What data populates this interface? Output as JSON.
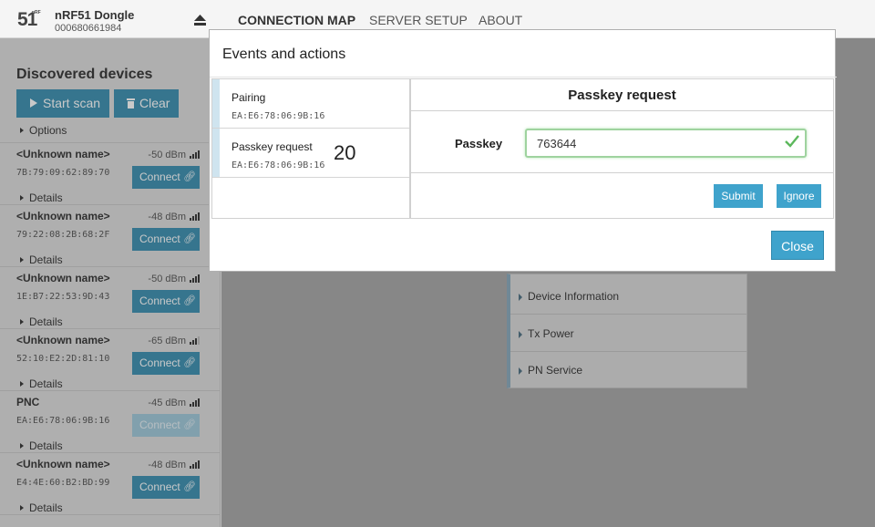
{
  "header": {
    "logo_number": "51",
    "logo_small_text": "nRF",
    "device_title": "nRF51 Dongle",
    "device_serial": "000680661984",
    "eject_icon": "eject-icon",
    "nav": [
      "CONNECTION MAP",
      "SERVER SETUP",
      "ABOUT"
    ],
    "active_nav": "CONNECTION MAP"
  },
  "sidebar": {
    "title": "Discovered devices",
    "start_scan_label": "Start scan",
    "clear_label": "Clear",
    "options_label": "Options",
    "connect_label": "Connect",
    "details_label": "Details",
    "devices": [
      {
        "name": "<Unknown name>",
        "rssi": "-50 dBm",
        "signal_bars": 4,
        "address": "7B:79:09:62:89:70",
        "connect_enabled": true
      },
      {
        "name": "<Unknown name>",
        "rssi": "-48 dBm",
        "signal_bars": 4,
        "address": "79:22:08:2B:68:2F",
        "connect_enabled": true
      },
      {
        "name": "<Unknown name>",
        "rssi": "-50 dBm",
        "signal_bars": 4,
        "address": "1E:B7:22:53:9D:43",
        "connect_enabled": true
      },
      {
        "name": "<Unknown name>",
        "rssi": "-65 dBm",
        "signal_bars": 3,
        "address": "52:10:E2:2D:81:10",
        "connect_enabled": true
      },
      {
        "name": "PNC",
        "rssi": "-45 dBm",
        "signal_bars": 4,
        "address": "EA:E6:78:06:9B:16",
        "connect_enabled": false
      },
      {
        "name": "<Unknown name>",
        "rssi": "-48 dBm",
        "signal_bars": 4,
        "address": "E4:4E:60:B2:BD:99",
        "connect_enabled": true
      }
    ]
  },
  "services": [
    "Device Information",
    "Tx Power",
    "PN Service"
  ],
  "modal": {
    "title": "Events and actions",
    "events": [
      {
        "title": "Pairing",
        "address": "EA:E6:78:06:9B:16",
        "count": ""
      },
      {
        "title": "Passkey request",
        "address": "EA:E6:78:06:9B:16",
        "count": "20"
      }
    ],
    "detail_title": "Passkey request",
    "passkey_label": "Passkey",
    "passkey_value": "763644",
    "submit_label": "Submit",
    "ignore_label": "Ignore",
    "close_label": "Close"
  },
  "colors": {
    "button_blue": "#3b8fb0",
    "modal_button_blue": "#3fa3cc",
    "valid_green": "#5cb85c"
  }
}
